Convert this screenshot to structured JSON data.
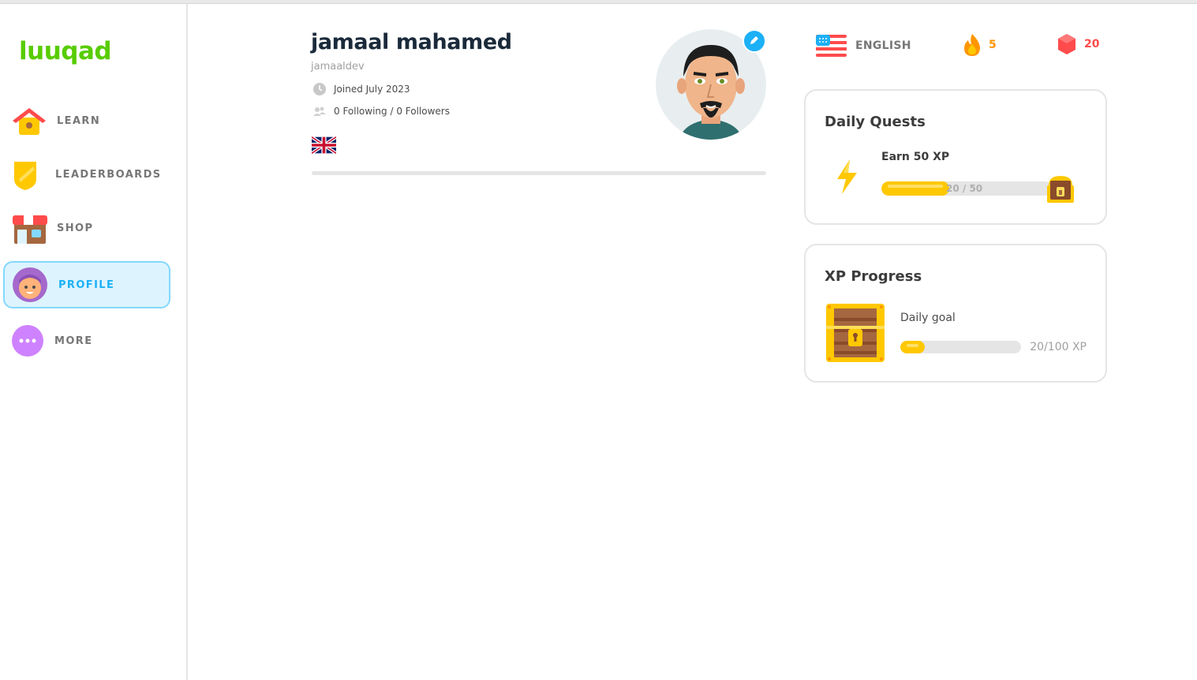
{
  "app": {
    "logo": "luuqad"
  },
  "sidebar": {
    "items": [
      {
        "label": "LEARN",
        "icon": "home-icon",
        "active": false
      },
      {
        "label": "LEADERBOARDS",
        "icon": "shield-icon",
        "active": false
      },
      {
        "label": "SHOP",
        "icon": "shop-icon",
        "active": false
      },
      {
        "label": "PROFILE",
        "icon": "profile-avatar-icon",
        "active": true
      },
      {
        "label": "MORE",
        "icon": "more-dots-icon",
        "active": false
      }
    ]
  },
  "profile": {
    "name": "jamaal mahamed",
    "username": "jamaaldev",
    "joined": "Joined July 2023",
    "follow": "0 Following / 0 Followers",
    "flag": "uk-flag-icon"
  },
  "stats": {
    "language": "ENGLISH",
    "language_flag": "us-flag-icon",
    "streak": "5",
    "gems": "20"
  },
  "daily_quests": {
    "title": "Daily Quests",
    "quest_label": "Earn 50 XP",
    "progress_text": "20 / 50",
    "progress_fraction": 0.4
  },
  "xp_progress": {
    "title": "XP Progress",
    "goal_label": "Daily goal",
    "progress_text": "20/100 XP",
    "progress_fraction": 0.2
  },
  "colors": {
    "brand": "#58cc02",
    "accent": "#1cb0f6",
    "streak": "#ff9600",
    "gems": "#ff4b4b",
    "progress": "#ffc800"
  }
}
